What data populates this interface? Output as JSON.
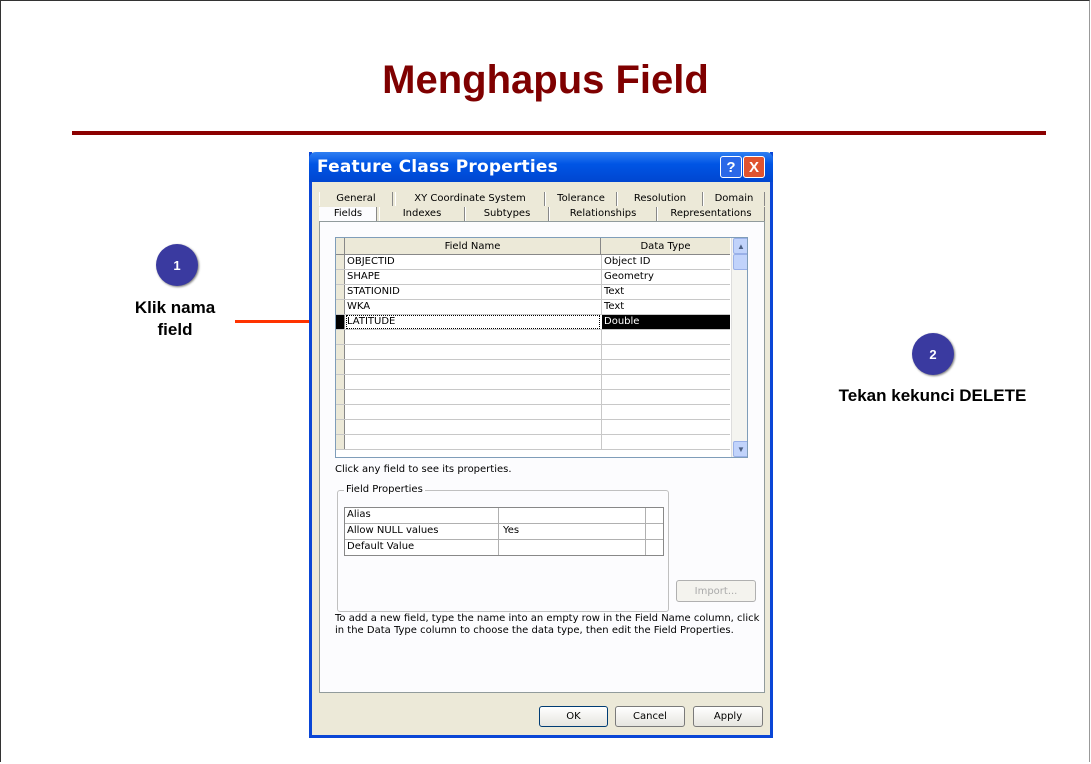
{
  "slide": {
    "title": "Menghapus Field",
    "step1": {
      "number": "1",
      "label_line1": "Klik nama",
      "label_line2": "field"
    },
    "step2": {
      "number": "2",
      "label": "Tekan kekunci DELETE"
    },
    "colors": {
      "title": "#7f0000",
      "rule": "#8b0000",
      "badge": "#3a3aa0",
      "arrow": "#ff3300"
    }
  },
  "dialog": {
    "title": "Feature Class Properties",
    "help_glyph": "?",
    "close_glyph": "X",
    "tabs_back": [
      "General",
      "XY Coordinate System",
      "Tolerance",
      "Resolution",
      "Domain"
    ],
    "tabs_front": [
      "Fields",
      "Indexes",
      "Subtypes",
      "Relationships",
      "Representations"
    ],
    "active_tab": "Fields",
    "grid": {
      "headers": {
        "name": "Field Name",
        "type": "Data Type"
      },
      "rows": [
        {
          "name": "OBJECTID",
          "type": "Object ID"
        },
        {
          "name": "SHAPE",
          "type": "Geometry"
        },
        {
          "name": "STATIONID",
          "type": "Text"
        },
        {
          "name": "WKA",
          "type": "Text"
        },
        {
          "name": "LATITUDE",
          "type": "Double"
        }
      ],
      "selected_row": "LATITUDE",
      "scroll_up": "▲",
      "scroll_down": "▼"
    },
    "hint": "Click any field to see its properties.",
    "field_properties": {
      "legend": "Field Properties",
      "rows": [
        {
          "key": "Alias",
          "value": ""
        },
        {
          "key": "Allow NULL values",
          "value": "Yes"
        },
        {
          "key": "Default Value",
          "value": ""
        }
      ]
    },
    "import_label": "Import...",
    "instructions": "To add a new field, type the name into an empty row in the Field Name column, click in the Data Type column to choose the data type, then edit the Field Properties.",
    "buttons": {
      "ok": "OK",
      "cancel": "Cancel",
      "apply": "Apply"
    }
  }
}
